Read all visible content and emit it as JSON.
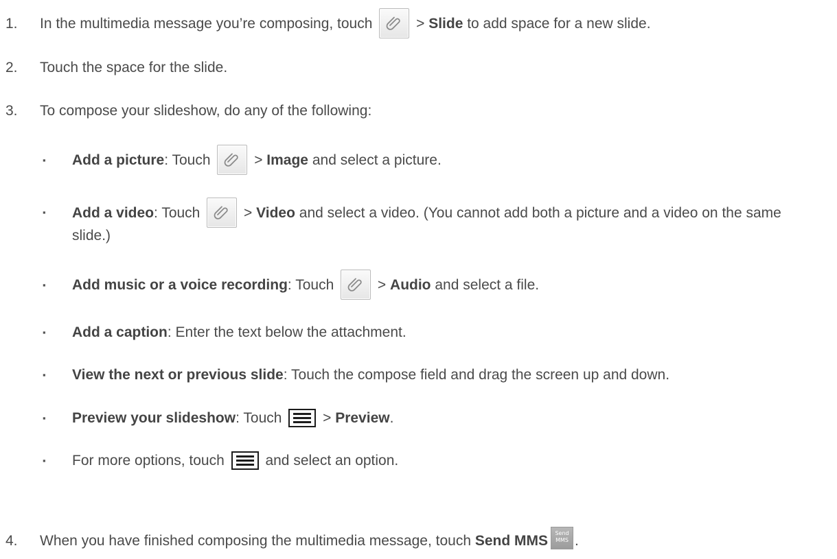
{
  "steps": [
    {
      "num": "1.",
      "before": "In the multimedia message you’re composing, touch ",
      "bold": "Slide",
      "after": " to add space for a new slide."
    },
    {
      "num": "2.",
      "text": "Touch the space for the slide."
    },
    {
      "num": "3.",
      "text": "To compose your slideshow, do any of the following:"
    },
    {
      "num": "4.",
      "before": "When you have finished composing the multimedia message, touch ",
      "bold": "Send MMS",
      "after": "."
    }
  ],
  "bullets": [
    {
      "bold": "Add a picture",
      "pre": ": Touch ",
      "bold2": "Image",
      "post": " and select a picture."
    },
    {
      "bold": "Add a video",
      "pre": ": Touch ",
      "bold2": "Video",
      "post": " and select a video. (You cannot add both a picture and a video on the same slide.)"
    },
    {
      "bold": "Add music or a voice recording",
      "pre": ": Touch ",
      "bold2": "Audio",
      "post": " and select a file."
    },
    {
      "bold": "Add a caption",
      "text": ": Enter the text below the attachment."
    },
    {
      "bold": "View the next or previous slide",
      "text": ": Touch the compose field and drag the screen up and down."
    },
    {
      "bold": "Preview your slideshow",
      "pre": ": Touch ",
      "bold2": "Preview",
      "post": "."
    },
    {
      "text": "For more options, touch ",
      "post": " and select an option."
    }
  ],
  "icons": {
    "attach": "paperclip-icon",
    "menu": "menu-icon",
    "send": "send-mms-icon",
    "send_label_line1": "Send",
    "send_label_line2": "MMS",
    "bullet_glyph": "▪",
    "gt": " > "
  }
}
